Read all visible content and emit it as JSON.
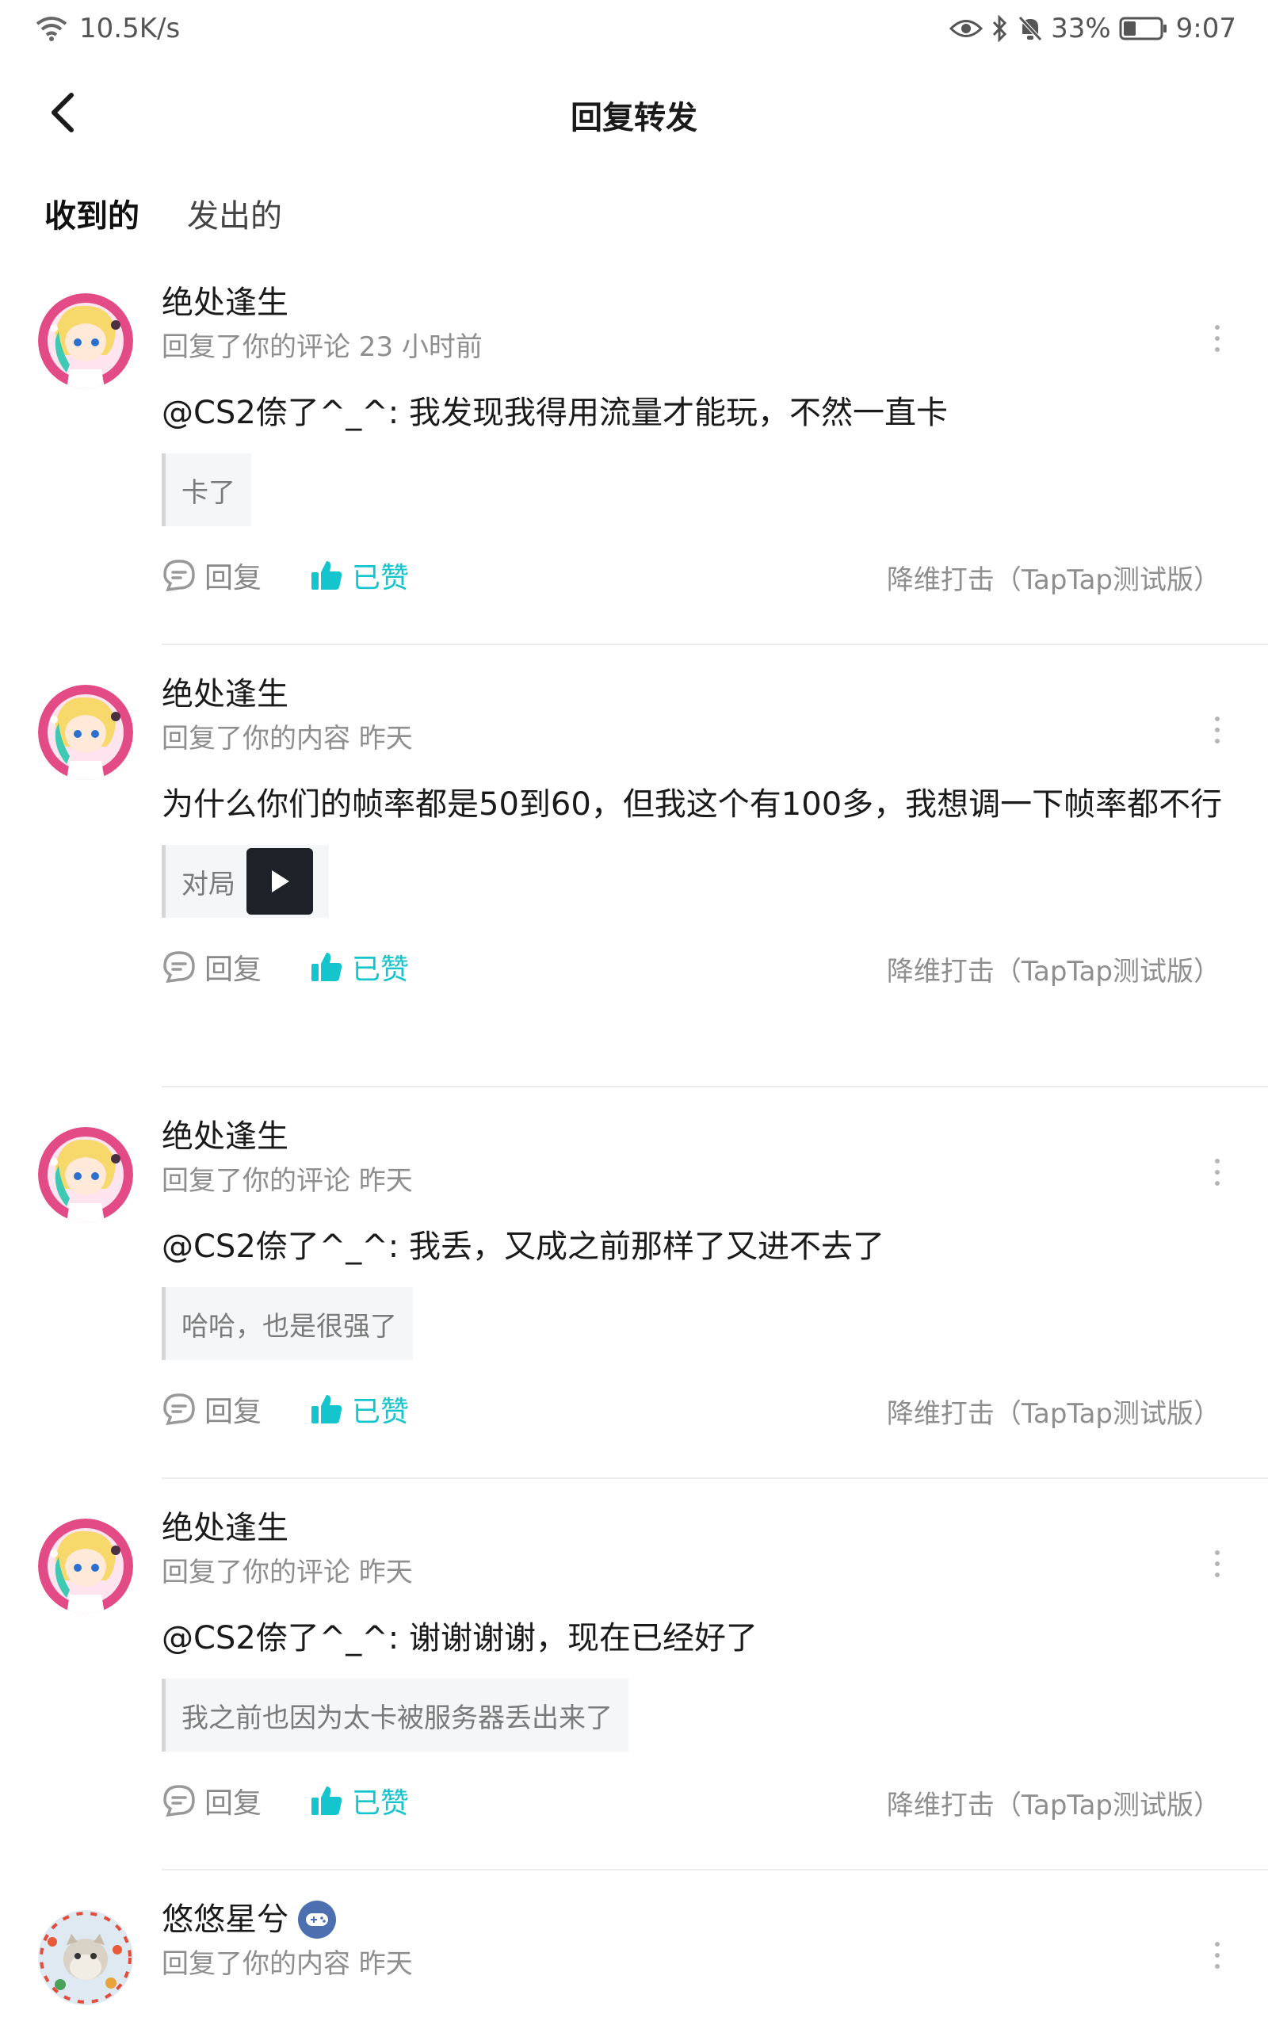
{
  "status_bar": {
    "speed": "10.5K/s",
    "battery_pct": "33%",
    "time": "9:07",
    "battery_level": 0.33
  },
  "header": {
    "title": "回复转发",
    "back_icon": "chevron-left-icon"
  },
  "tabs": [
    {
      "label": "收到的",
      "active": true
    },
    {
      "label": "发出的",
      "active": false
    }
  ],
  "accent_color": "#15c5ce",
  "items": [
    {
      "username": "绝处逢生",
      "meta": "回复了你的评论 23 小时前",
      "text": "@CS2倷了^_^: 我发现我得用流量才能玩，不然一直卡",
      "quote": "卡了",
      "has_video": false,
      "reply_label": "回复",
      "like_label": "已赞",
      "source": "降维打击（TapTap测试版）"
    },
    {
      "username": "绝处逢生",
      "meta": "回复了你的内容 昨天",
      "text": "为什么你们的帧率都是50到60，但我这个有100多，我想调一下帧率都不行",
      "quote": "对局",
      "has_video": true,
      "reply_label": "回复",
      "like_label": "已赞",
      "source": "降维打击（TapTap测试版）"
    },
    {
      "username": "绝处逢生",
      "meta": "回复了你的评论 昨天",
      "text": "@CS2倷了^_^: 我丢，又成之前那样了又进不去了",
      "quote": "哈哈，也是很强了",
      "has_video": false,
      "reply_label": "回复",
      "like_label": "已赞",
      "source": "降维打击（TapTap测试版）"
    },
    {
      "username": "绝处逢生",
      "meta": "回复了你的评论 昨天",
      "text": "@CS2倷了^_^: 谢谢谢谢，现在已经好了",
      "quote": "我之前也因为太卡被服务器丢出来了",
      "has_video": false,
      "reply_label": "回复",
      "like_label": "已赞",
      "source": "降维打击（TapTap测试版）"
    },
    {
      "username": "悠悠星兮",
      "meta": "回复了你的内容 昨天",
      "badge_icon": "gamepad-badge-icon"
    }
  ]
}
